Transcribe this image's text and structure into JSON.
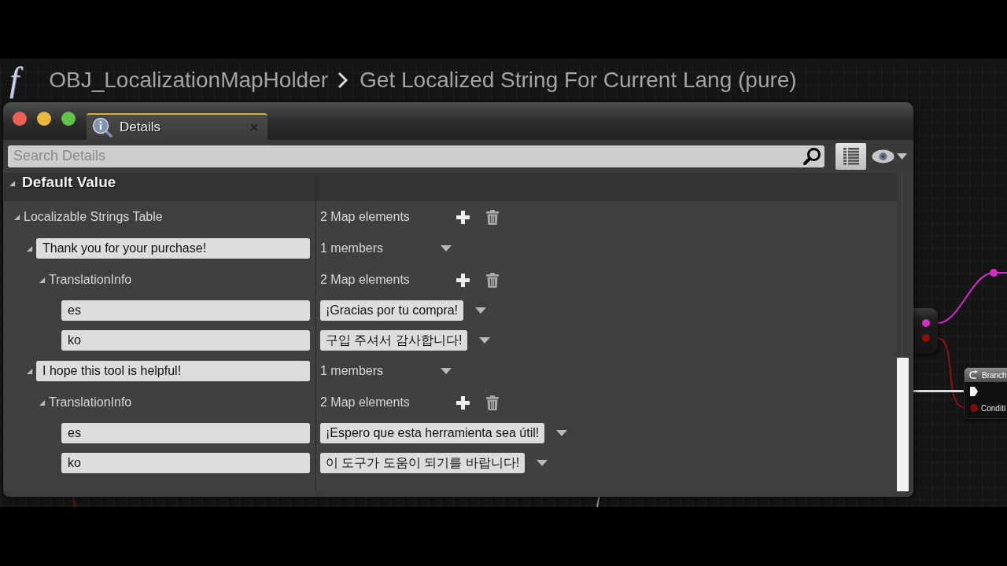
{
  "breadcrumb": {
    "function_icon": "f",
    "items": [
      "OBJ_LocalizationMapHolder",
      "Get Localized String For Current Lang (pure)"
    ]
  },
  "details_panel": {
    "tab": {
      "label": "Details",
      "selected": true
    },
    "search": {
      "placeholder": "Search Details"
    },
    "category": {
      "title": "Default Value",
      "expanded": true
    },
    "properties": [
      {
        "kind": "map",
        "name": "Localizable Strings Table",
        "value": "2 Map elements",
        "expanded": true,
        "children": [
          {
            "kind": "entry",
            "key": "Thank you for your purchase!",
            "value": "1 members",
            "expanded": true,
            "children": [
              {
                "kind": "map",
                "name": "TranslationInfo",
                "value": "2 Map elements",
                "expanded": true,
                "children": [
                  {
                    "kind": "pair",
                    "key": "es",
                    "value": "¡Gracias por tu compra!"
                  },
                  {
                    "kind": "pair",
                    "key": "ko",
                    "value": "구입 주셔서 감사합니다!"
                  }
                ]
              }
            ]
          },
          {
            "kind": "entry",
            "key": "I hope this tool is helpful!",
            "value": "1 members",
            "expanded": true,
            "children": [
              {
                "kind": "map",
                "name": "TranslationInfo",
                "value": "2 Map elements",
                "expanded": true,
                "children": [
                  {
                    "kind": "pair",
                    "key": "es",
                    "value": "¡Espero que esta herramienta sea útil!"
                  },
                  {
                    "kind": "pair",
                    "key": "ko",
                    "value": "이 도구가 도움이 되기를 바랍니다!"
                  }
                ]
              }
            ]
          }
        ]
      }
    ]
  },
  "graph": {
    "nodes": [
      {
        "kind": "plain",
        "pins": [
          {
            "kind": "data",
            "color": "#d62ccc"
          },
          {
            "kind": "data",
            "color": "#8e1010"
          }
        ]
      },
      {
        "kind": "reroute",
        "pins": [
          {
            "kind": "data",
            "color": "#d62ccc"
          }
        ]
      },
      {
        "kind": "titled",
        "title": "Branch",
        "pins": [
          {
            "kind": "exec"
          },
          {
            "kind": "data",
            "color": "#7e0c0c",
            "label": "Conditi"
          }
        ]
      }
    ]
  }
}
